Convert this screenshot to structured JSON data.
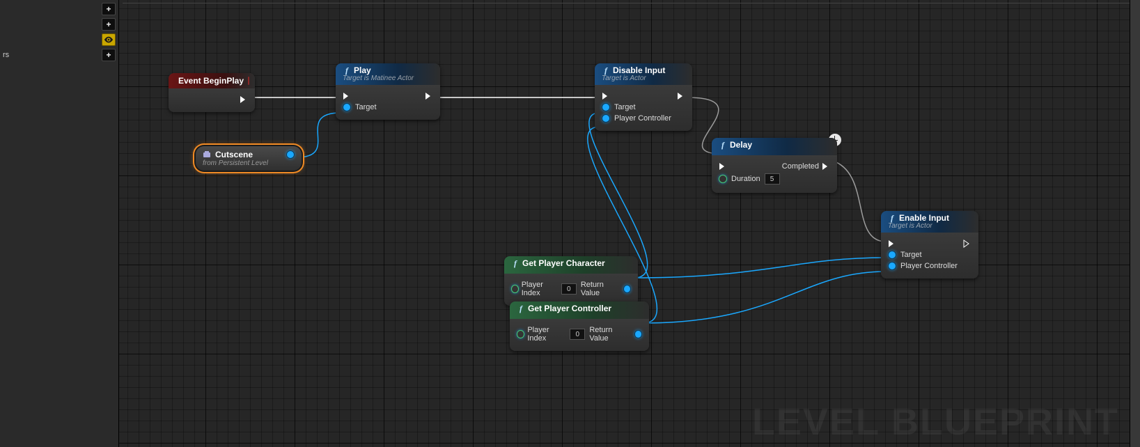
{
  "watermark": "LEVEL BLUEPRINT",
  "sidebar": {
    "row0_label": "",
    "row1_label": "",
    "row2_label": "",
    "row3_label": "rs"
  },
  "nodes": {
    "event": {
      "title": "Event BeginPlay"
    },
    "cutscene": {
      "title": "Cutscene",
      "sub": "from Persistent Level"
    },
    "play": {
      "title": "Play",
      "sub": "Target is Matinee Actor",
      "target": "Target"
    },
    "disable": {
      "title": "Disable Input",
      "sub": "Target is Actor",
      "target": "Target",
      "pc": "Player Controller"
    },
    "delay": {
      "title": "Delay",
      "duration_label": "Duration",
      "duration_val": "5",
      "completed": "Completed"
    },
    "getchar": {
      "title": "Get Player Character",
      "pi_label": "Player Index",
      "pi_val": "0",
      "rv": "Return Value"
    },
    "getpc": {
      "title": "Get Player Controller",
      "pi_label": "Player Index",
      "pi_val": "0",
      "rv": "Return Value"
    },
    "enable": {
      "title": "Enable Input",
      "sub": "Target is Actor",
      "target": "Target",
      "pc": "Player Controller"
    }
  }
}
